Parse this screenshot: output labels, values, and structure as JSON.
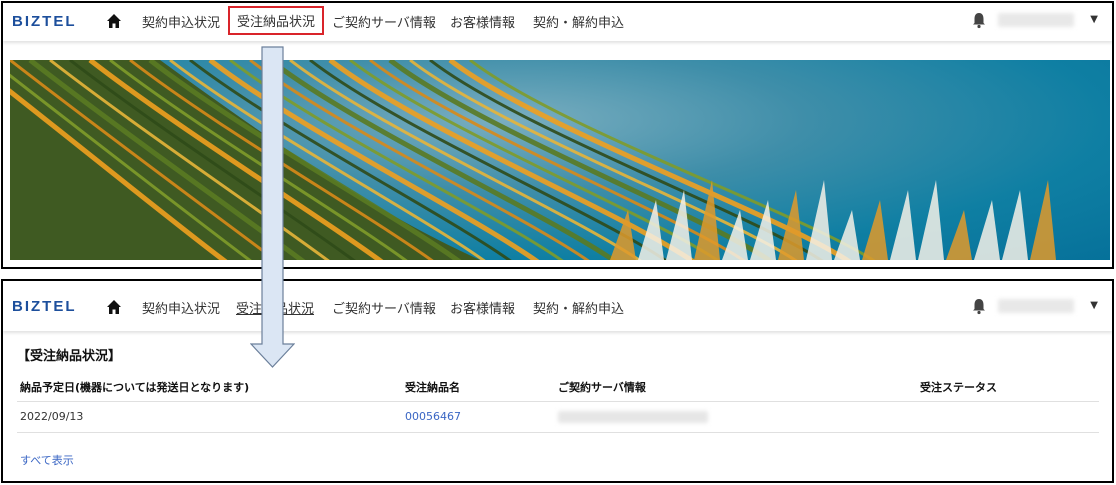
{
  "header": {
    "logo": "BIZTEL",
    "nav": [
      {
        "label": "契約申込状況"
      },
      {
        "label": "受注納品状況"
      },
      {
        "label": "ご契約サーバ情報"
      },
      {
        "label": "お客様情報"
      },
      {
        "label": "契約・解約申込"
      }
    ],
    "icons": {
      "home": "home-icon",
      "notification": "bell-icon",
      "menu": "caret-down-icon"
    }
  },
  "orders_page": {
    "title": "【受注納品状況】",
    "columns": [
      "納品予定日(機器については発送日となります)",
      "受注納品名",
      "ご契約サーバ情報",
      "受注ステータス"
    ],
    "rows": [
      {
        "date": "2022/09/13",
        "order_name": "00056467",
        "server": "",
        "status": ""
      }
    ],
    "show_all": "すべて表示"
  },
  "colors": {
    "logo": "#1d4f9c",
    "highlight_border": "#d9242a",
    "link": "#3a66c4",
    "arrow_fill": "#dbe6f4",
    "arrow_stroke": "#6b7f9a"
  }
}
